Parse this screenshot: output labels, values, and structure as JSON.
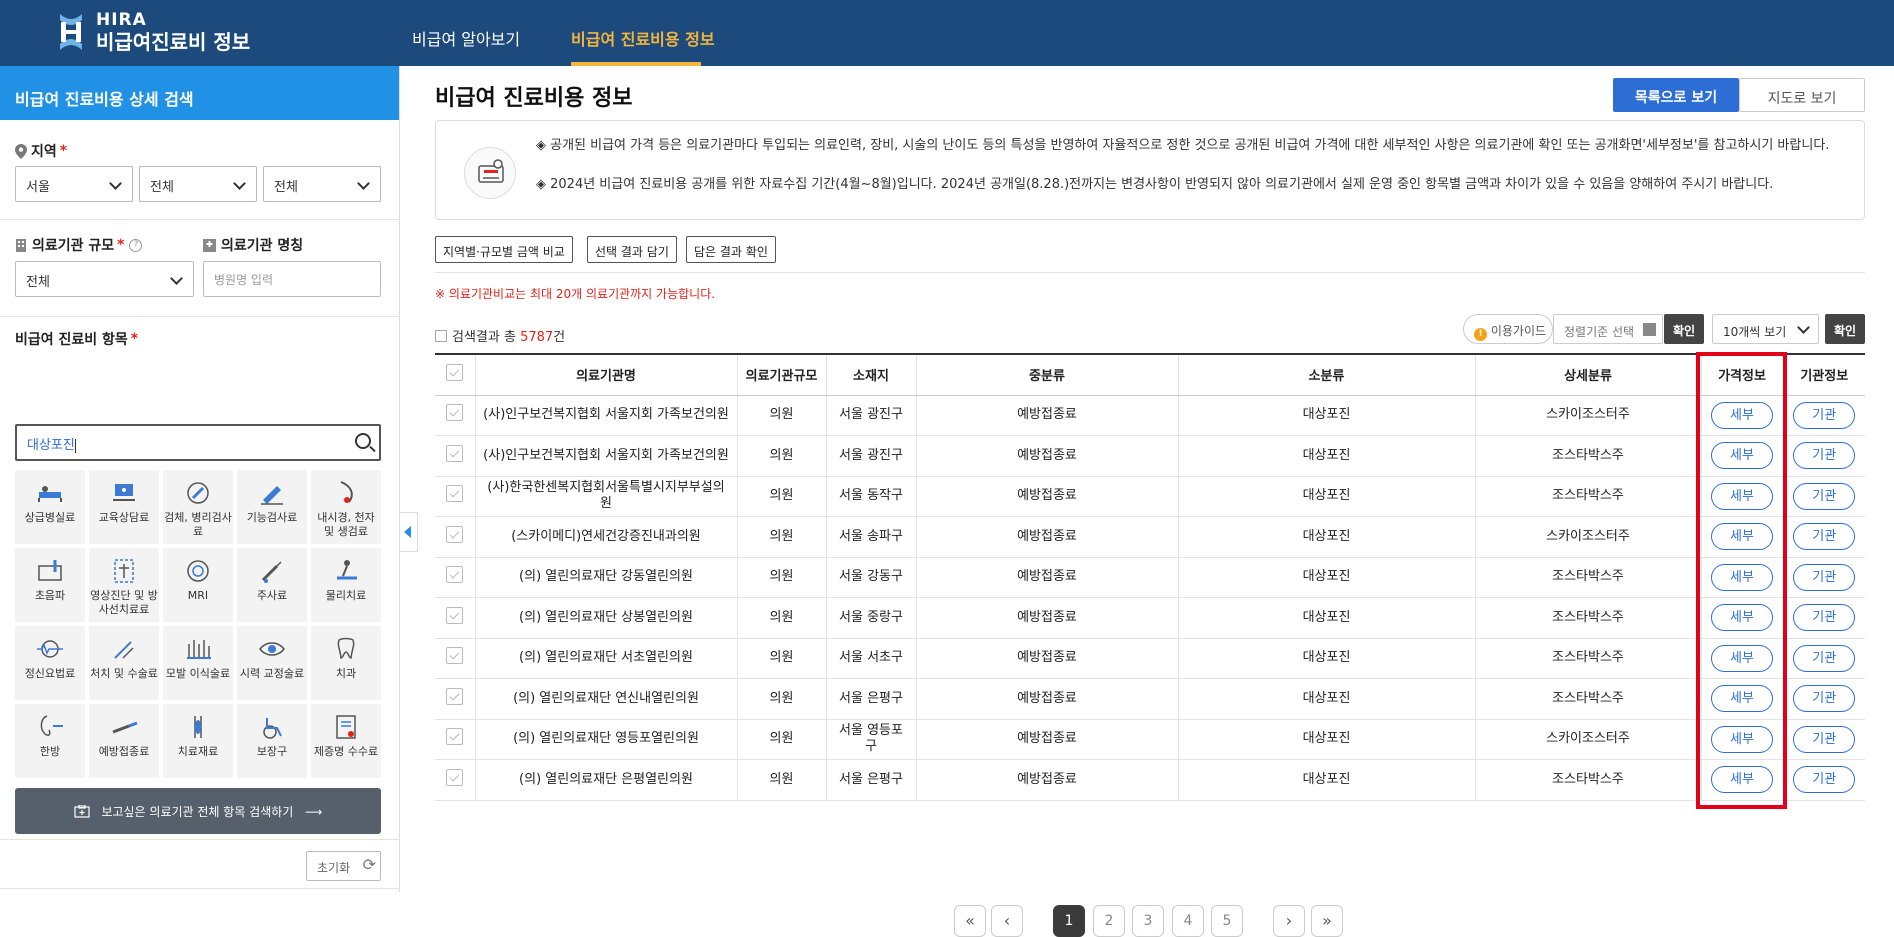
{
  "header": {
    "logo_line1": "HIRA",
    "logo_line2": "비급여진료비 정보",
    "nav": [
      {
        "label": "비급여 알아보기"
      },
      {
        "label": "비급여 진료비용 정보"
      }
    ],
    "colors": {
      "bar": "#1d4a7c",
      "active": "#f3b53b"
    }
  },
  "sidebar": {
    "title": "비급여 진료비용 상세 검색",
    "region_label": "지역",
    "region_required": "*",
    "region_selects": [
      "서울",
      "전체",
      "전체"
    ],
    "scale_label": "의료기관 규모",
    "scale_required": "*",
    "scale_value": "전체",
    "name_label": "의료기관 명칭",
    "name_placeholder": "병원명 입력",
    "item_label": "비급여 진료비 항목",
    "item_required": "*",
    "item_search_value": "대상포진",
    "categories": [
      {
        "label": "상급병실료",
        "icon": "hospital-bed-icon"
      },
      {
        "label": "교육상담료",
        "icon": "consultation-icon"
      },
      {
        "label": "검체, 병리검사료",
        "icon": "microscope-icon"
      },
      {
        "label": "기능검사료",
        "icon": "function-test-icon"
      },
      {
        "label": "내시경, 천자 및 생검료",
        "icon": "endoscope-icon"
      },
      {
        "label": "초음파",
        "icon": "ultrasound-icon"
      },
      {
        "label": "영상진단 및 방사선치료료",
        "icon": "radiology-icon"
      },
      {
        "label": "MRI",
        "icon": "mri-icon"
      },
      {
        "label": "주사료",
        "icon": "syringe-icon"
      },
      {
        "label": "물리치료",
        "icon": "physiotherapy-icon"
      },
      {
        "label": "정신요법료",
        "icon": "brain-wave-icon"
      },
      {
        "label": "처치 및 수술료",
        "icon": "surgery-icon"
      },
      {
        "label": "모발 이식술료",
        "icon": "hair-transplant-icon"
      },
      {
        "label": "시력 교정술료",
        "icon": "eye-icon"
      },
      {
        "label": "치과",
        "icon": "tooth-icon"
      },
      {
        "label": "한방",
        "icon": "acupuncture-icon"
      },
      {
        "label": "예방접종료",
        "icon": "vaccine-icon"
      },
      {
        "label": "치료재료",
        "icon": "material-icon"
      },
      {
        "label": "보장구",
        "icon": "wheelchair-icon"
      },
      {
        "label": "제증명 수수료",
        "icon": "certificate-icon"
      }
    ],
    "search_all_button": "보고싶은 의료기관 전체 항목 검색하기",
    "reset_button": "초기화"
  },
  "main": {
    "title": "비급여 진료비용 정보",
    "view_list": "목록으로 보기",
    "view_map": "지도로 보기",
    "notice_1": "◈ 공개된 비급여 가격 등은 의료기관마다 투입되는 의료인력, 장비, 시술의 난이도 등의 특성을 반영하여 자율적으로 정한 것으로 공개된 비급여 가격에 대한 세부적인 사항은 의료기관에 확인 또는 공개화면'세부정보'를 참고하시기 바랍니다.",
    "notice_2": "◈ 2024년 비급여 진료비용 공개를 위한 자료수집 기간(4월~8월)입니다. 2024년 공개일(8.28.)전까지는 변경사항이 반영되지 않아 의료기관에서 실제 운영 중인 항목별 금액과 차이가 있을 수 있음을 양해하여 주시기 바랍니다.",
    "btn_compare": "지역별·규모별 금액 비교",
    "btn_add": "선택 결과 담기",
    "btn_check": "담은 결과 확인",
    "warning": "※ 의료기관비교는 최대 20개 의료기관까지 가능합니다.",
    "result_prefix": "검색결과 총",
    "result_count": "5787",
    "result_suffix": "건",
    "guide_button": "이용가이드",
    "sort_select": "정렬기준 선택",
    "confirm_1": "확인",
    "per_page": "10개씩 보기",
    "confirm_2": "확인",
    "columns": [
      "의료기관명",
      "의료기관규모",
      "소재지",
      "중분류",
      "소분류",
      "상세분류",
      "가격정보",
      "기관정보"
    ],
    "rows": [
      {
        "name": "(사)인구보건복지협회 서울지회 가족보건의원",
        "scale": "의원",
        "loc": "서울 광진구",
        "mid": "예방접종료",
        "small": "대상포진",
        "detail": "스카이조스터주",
        "price": "세부",
        "inst": "기관"
      },
      {
        "name": "(사)인구보건복지협회 서울지회 가족보건의원",
        "scale": "의원",
        "loc": "서울 광진구",
        "mid": "예방접종료",
        "small": "대상포진",
        "detail": "조스타박스주",
        "price": "세부",
        "inst": "기관"
      },
      {
        "name": "(사)한국한센복지협회서울특별시지부부설의원",
        "scale": "의원",
        "loc": "서울 동작구",
        "mid": "예방접종료",
        "small": "대상포진",
        "detail": "조스타박스주",
        "price": "세부",
        "inst": "기관"
      },
      {
        "name": "(스카이메디)연세건강증진내과의원",
        "scale": "의원",
        "loc": "서울 송파구",
        "mid": "예방접종료",
        "small": "대상포진",
        "detail": "스카이조스터주",
        "price": "세부",
        "inst": "기관"
      },
      {
        "name": "(의) 열린의료재단 강동열린의원",
        "scale": "의원",
        "loc": "서울 강동구",
        "mid": "예방접종료",
        "small": "대상포진",
        "detail": "조스타박스주",
        "price": "세부",
        "inst": "기관"
      },
      {
        "name": "(의) 열린의료재단 상봉열린의원",
        "scale": "의원",
        "loc": "서울 중랑구",
        "mid": "예방접종료",
        "small": "대상포진",
        "detail": "조스타박스주",
        "price": "세부",
        "inst": "기관"
      },
      {
        "name": "(의) 열린의료재단 서초열린의원",
        "scale": "의원",
        "loc": "서울 서초구",
        "mid": "예방접종료",
        "small": "대상포진",
        "detail": "조스타박스주",
        "price": "세부",
        "inst": "기관"
      },
      {
        "name": "(의) 열린의료재단 연신내열린의원",
        "scale": "의원",
        "loc": "서울 은평구",
        "mid": "예방접종료",
        "small": "대상포진",
        "detail": "조스타박스주",
        "price": "세부",
        "inst": "기관"
      },
      {
        "name": "(의) 열린의료재단 영등포열린의원",
        "scale": "의원",
        "loc": "서울 영등포구",
        "mid": "예방접종료",
        "small": "대상포진",
        "detail": "스카이조스터주",
        "price": "세부",
        "inst": "기관"
      },
      {
        "name": "(의) 열린의료재단 은평열린의원",
        "scale": "의원",
        "loc": "서울 은평구",
        "mid": "예방접종료",
        "small": "대상포진",
        "detail": "조스타박스주",
        "price": "세부",
        "inst": "기관"
      }
    ],
    "pages": [
      "1",
      "2",
      "3",
      "4",
      "5"
    ],
    "current_page": "1",
    "colors": {
      "primary": "#2d6ed6",
      "highlight": "#e2001a"
    }
  }
}
